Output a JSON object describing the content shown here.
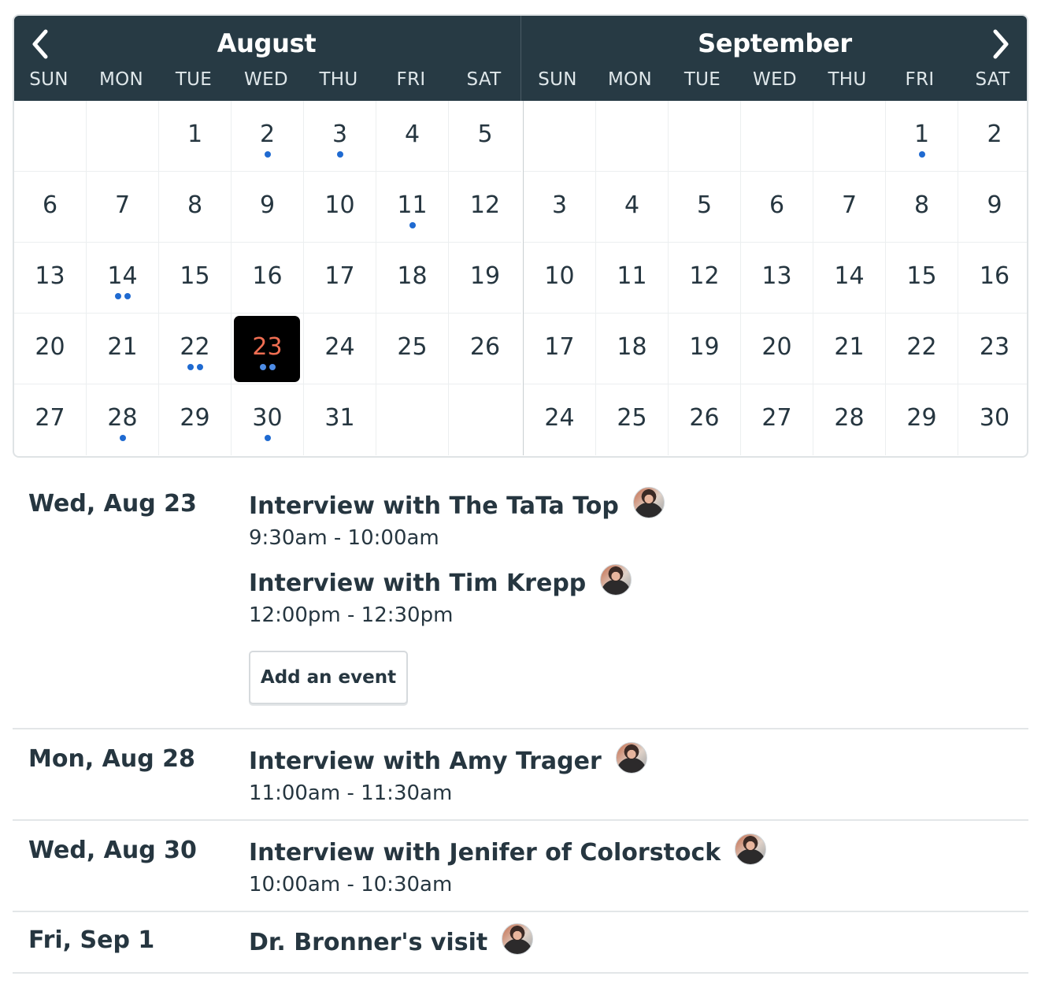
{
  "calendar": {
    "prev_label": "previous month",
    "next_label": "next month",
    "months": [
      {
        "name": "August",
        "weekdays": [
          "SUN",
          "MON",
          "TUE",
          "WED",
          "THU",
          "FRI",
          "SAT"
        ],
        "cells": [
          {
            "day": ""
          },
          {
            "day": ""
          },
          {
            "day": "1"
          },
          {
            "day": "2",
            "dots": 1
          },
          {
            "day": "3",
            "dots": 1
          },
          {
            "day": "4"
          },
          {
            "day": "5"
          },
          {
            "day": "6"
          },
          {
            "day": "7"
          },
          {
            "day": "8"
          },
          {
            "day": "9"
          },
          {
            "day": "10"
          },
          {
            "day": "11",
            "dots": 1
          },
          {
            "day": "12"
          },
          {
            "day": "13"
          },
          {
            "day": "14",
            "dots": 2
          },
          {
            "day": "15"
          },
          {
            "day": "16"
          },
          {
            "day": "17"
          },
          {
            "day": "18"
          },
          {
            "day": "19"
          },
          {
            "day": "20"
          },
          {
            "day": "21"
          },
          {
            "day": "22",
            "dots": 2
          },
          {
            "day": "23",
            "dots": 2,
            "selected": true
          },
          {
            "day": "24"
          },
          {
            "day": "25"
          },
          {
            "day": "26"
          },
          {
            "day": "27"
          },
          {
            "day": "28",
            "dots": 1
          },
          {
            "day": "29"
          },
          {
            "day": "30",
            "dots": 1
          },
          {
            "day": "31"
          },
          {
            "day": ""
          },
          {
            "day": ""
          }
        ]
      },
      {
        "name": "September",
        "weekdays": [
          "SUN",
          "MON",
          "TUE",
          "WED",
          "THU",
          "FRI",
          "SAT"
        ],
        "cells": [
          {
            "day": ""
          },
          {
            "day": ""
          },
          {
            "day": ""
          },
          {
            "day": ""
          },
          {
            "day": ""
          },
          {
            "day": "1",
            "dots": 1
          },
          {
            "day": "2"
          },
          {
            "day": "3"
          },
          {
            "day": "4"
          },
          {
            "day": "5"
          },
          {
            "day": "6"
          },
          {
            "day": "7"
          },
          {
            "day": "8"
          },
          {
            "day": "9"
          },
          {
            "day": "10"
          },
          {
            "day": "11"
          },
          {
            "day": "12"
          },
          {
            "day": "13"
          },
          {
            "day": "14"
          },
          {
            "day": "15"
          },
          {
            "day": "16"
          },
          {
            "day": "17"
          },
          {
            "day": "18"
          },
          {
            "day": "19"
          },
          {
            "day": "20"
          },
          {
            "day": "21"
          },
          {
            "day": "22"
          },
          {
            "day": "23"
          },
          {
            "day": "24"
          },
          {
            "day": "25"
          },
          {
            "day": "26"
          },
          {
            "day": "27"
          },
          {
            "day": "28"
          },
          {
            "day": "29"
          },
          {
            "day": "30"
          }
        ]
      }
    ],
    "colors": {
      "header_bg": "#273a44",
      "event_dot": "#1f6ad1",
      "selected_bg": "#000000",
      "selected_text": "#f06e52"
    }
  },
  "agenda": {
    "add_event_label": "Add an event",
    "days": [
      {
        "label": "Wed, Aug 23",
        "events": [
          {
            "title": "Interview with The TaTa Top",
            "time": "9:30am - 10:00am"
          },
          {
            "title": "Interview with Tim Krepp",
            "time": "12:00pm - 12:30pm"
          }
        ]
      },
      {
        "label": "Mon, Aug 28",
        "events": [
          {
            "title": "Interview with Amy Trager",
            "time": "11:00am - 11:30am"
          }
        ]
      },
      {
        "label": "Wed, Aug 30",
        "events": [
          {
            "title": "Interview with Jenifer of Colorstock",
            "time": "10:00am - 10:30am"
          }
        ]
      },
      {
        "label": "Fri, Sep 1",
        "events": [
          {
            "title": "Dr. Bronner's visit",
            "time": ""
          }
        ]
      }
    ]
  }
}
